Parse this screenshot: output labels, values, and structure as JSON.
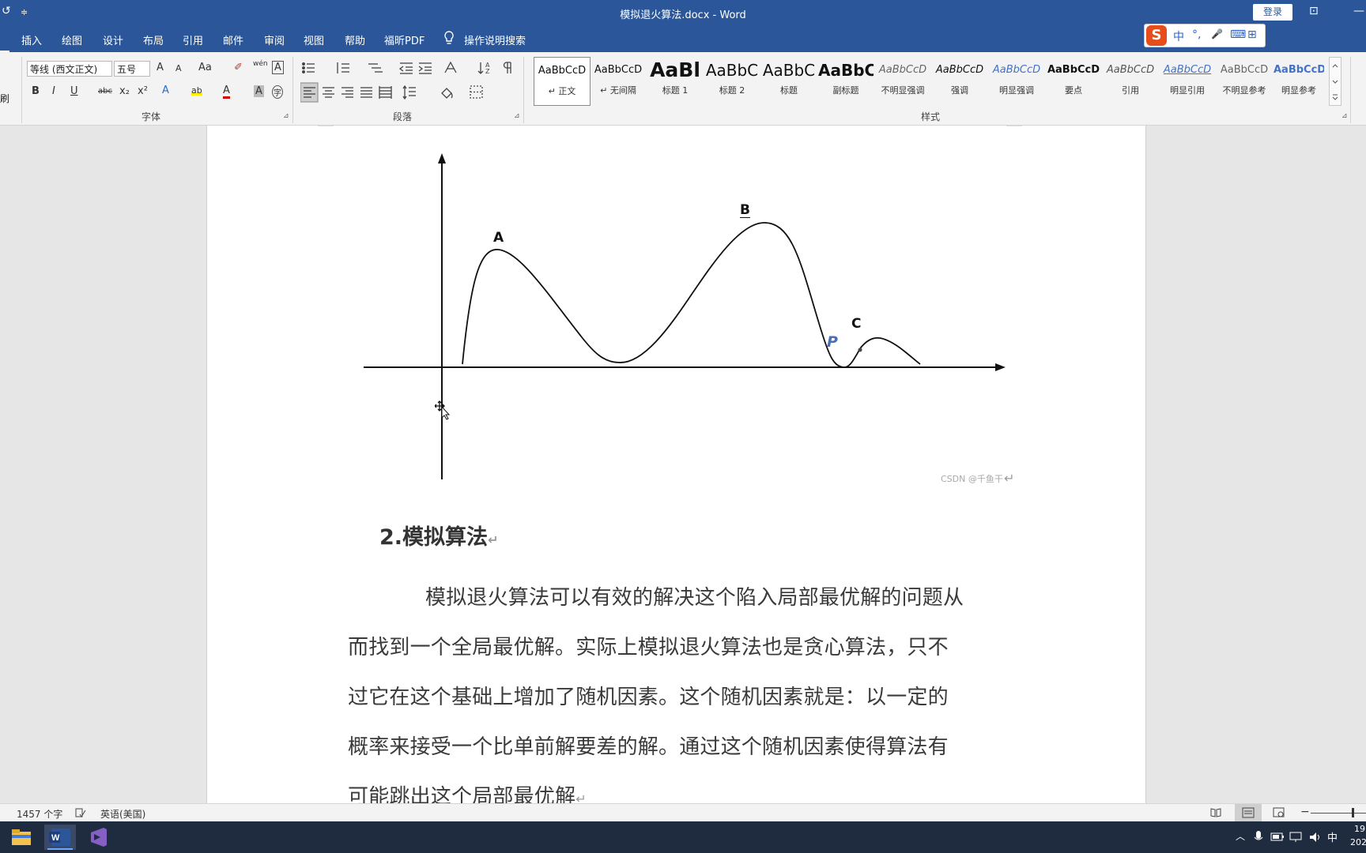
{
  "window": {
    "title": "模拟退火算法.docx  -  Word",
    "login_label": "登录",
    "quick_access": [
      "↺",
      "≑"
    ],
    "controls": [
      "⊡",
      "—"
    ]
  },
  "tabs": [
    "插入",
    "绘图",
    "设计",
    "布局",
    "引用",
    "邮件",
    "审阅",
    "视图",
    "帮助",
    "福昕PDF"
  ],
  "tell_me": "操作说明搜索",
  "ime": {
    "logo": "S",
    "items": [
      "中",
      "°,",
      "🎤",
      "⌨",
      "⊞"
    ]
  },
  "ribbon": {
    "clipboard_fragment": "刷",
    "font": {
      "label": "字体",
      "font_name": "等线 (西文正文)",
      "font_size": "五号",
      "row1_buttons": [
        "A",
        "A",
        "Aa",
        "✐",
        "wén",
        "A"
      ],
      "row2_buttons": [
        "B",
        "I",
        "U",
        "abc",
        "x₂",
        "x²",
        "A",
        "ab",
        "A",
        "A",
        "字"
      ]
    },
    "paragraph": {
      "label": "段落"
    },
    "styles": {
      "label": "样式",
      "items": [
        {
          "sample": "AaBbCcD",
          "name": "↵ 正文"
        },
        {
          "sample": "AaBbCcD",
          "name": "↵ 无间隔"
        },
        {
          "sample": "AaBl",
          "name": "标题 1"
        },
        {
          "sample": "AaBbC",
          "name": "标题 2"
        },
        {
          "sample": "AaBbC",
          "name": "标题"
        },
        {
          "sample": "AaBbC",
          "name": "副标题"
        },
        {
          "sample": "AaBbCcD",
          "name": "不明显强调"
        },
        {
          "sample": "AaBbCcD",
          "name": "强调"
        },
        {
          "sample": "AaBbCcD",
          "name": "明显强调"
        },
        {
          "sample": "AaBbCcD",
          "name": "要点"
        },
        {
          "sample": "AaBbCcD",
          "name": "引用"
        },
        {
          "sample": "AaBbCcD",
          "name": "明显引用"
        },
        {
          "sample": "AaBbCcD",
          "name": "不明显参考"
        },
        {
          "sample": "AaBbCcD",
          "name": "明显参考"
        }
      ]
    }
  },
  "document": {
    "figure": {
      "label_a": "A",
      "label_b": "B",
      "label_c": "C",
      "label_p": "P"
    },
    "watermark": "CSDN @千鱼干",
    "heading": "2.模拟算法",
    "paragraph_lines": [
      "模拟退火算法可以有效的解决这个陷入局部最优解的问题从",
      "而找到一个全局最优解。实际上模拟退火算法也是贪心算法，只不",
      "过它在这个基础上增加了随机因素。这个随机因素就是：以一定的",
      "概率来接受一个比单前解要差的解。通过这个随机因素使得算法有",
      "可能跳出这个局部最优解"
    ],
    "para_mark": "↵"
  },
  "status": {
    "word_count": "1457 个字",
    "language": "英语(美国)"
  },
  "tray": {
    "ime": "中",
    "clock_partial": "19",
    "date_partial": "202"
  },
  "colors": {
    "accent": "#2b579a",
    "taskbar": "#1f2b3f"
  }
}
